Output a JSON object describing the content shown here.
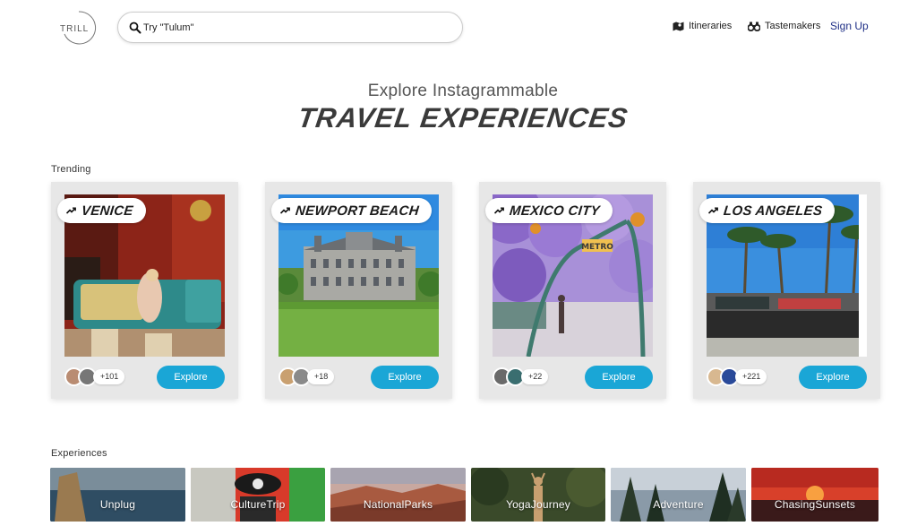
{
  "header": {
    "logo_text": "TRILL",
    "search_placeholder": "Try \"Tulum\"",
    "nav": {
      "itineraries": "Itineraries",
      "tastemakers": "Tastemakers",
      "signup": "Sign Up"
    }
  },
  "hero": {
    "subtitle": "Explore Instagrammable",
    "title": "TRAVEL EXPERIENCES"
  },
  "trending": {
    "label": "Trending",
    "cards": [
      {
        "title": "VENICE",
        "count": "+101",
        "explore": "Explore"
      },
      {
        "title": "NEWPORT BEACH",
        "count": "+18",
        "explore": "Explore"
      },
      {
        "title": "MEXICO CITY",
        "count": "+22",
        "explore": "Explore"
      },
      {
        "title": "LOS ANGELES",
        "count": "+221",
        "explore": "Explore"
      }
    ]
  },
  "experiences": {
    "label": "Experiences",
    "items": [
      "Unplug",
      "CultureTrip",
      "NationalParks",
      "YogaJourney",
      "Adventure",
      "ChasingSunsets"
    ]
  },
  "colors": {
    "accent": "#1aa6d6",
    "signup": "#1f2f86",
    "card_bg": "#e7e7e7"
  },
  "icons": [
    "search-icon",
    "map-icon",
    "binoculars-icon",
    "trending-icon"
  ]
}
